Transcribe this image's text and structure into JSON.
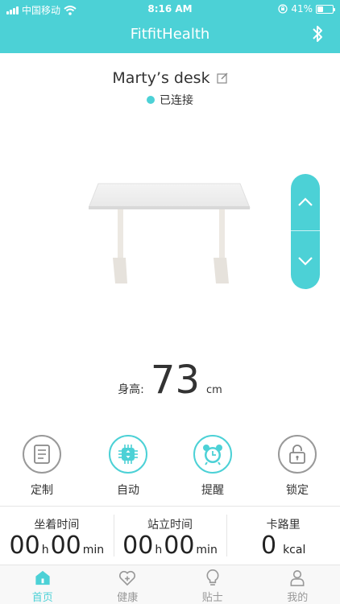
{
  "status_bar": {
    "carrier": "中国移动",
    "time": "8:16 AM",
    "battery_text": "41%",
    "battery_level": 0.41
  },
  "header": {
    "app_title": "FitfitHealth"
  },
  "device": {
    "name": "Marty’s desk",
    "connection_status": "已连接"
  },
  "height": {
    "label": "身高:",
    "value": "73",
    "unit": "cm"
  },
  "actions": [
    {
      "label": "定制",
      "icon": "document-icon"
    },
    {
      "label": "自动",
      "icon": "chip-icon"
    },
    {
      "label": "提醒",
      "icon": "alarm-clock-icon"
    },
    {
      "label": "锁定",
      "icon": "lock-icon"
    }
  ],
  "stats": {
    "sitting": {
      "title": "坐着时间",
      "hours": "00",
      "hours_unit": "h",
      "minutes": "00",
      "minutes_unit": "min"
    },
    "standing": {
      "title": "站立时间",
      "hours": "00",
      "hours_unit": "h",
      "minutes": "00",
      "minutes_unit": "min"
    },
    "calories": {
      "title": "卡路里",
      "value": "0",
      "unit": "kcal"
    }
  },
  "tabs": [
    {
      "label": "首页",
      "icon": "home-icon",
      "active": true
    },
    {
      "label": "健康",
      "icon": "heart-plus-icon",
      "active": false
    },
    {
      "label": "贴士",
      "icon": "lightbulb-icon",
      "active": false
    },
    {
      "label": "我的",
      "icon": "person-icon",
      "active": false
    }
  ],
  "colors": {
    "accent": "#4cd1d6",
    "text": "#333333",
    "muted": "#999999"
  }
}
